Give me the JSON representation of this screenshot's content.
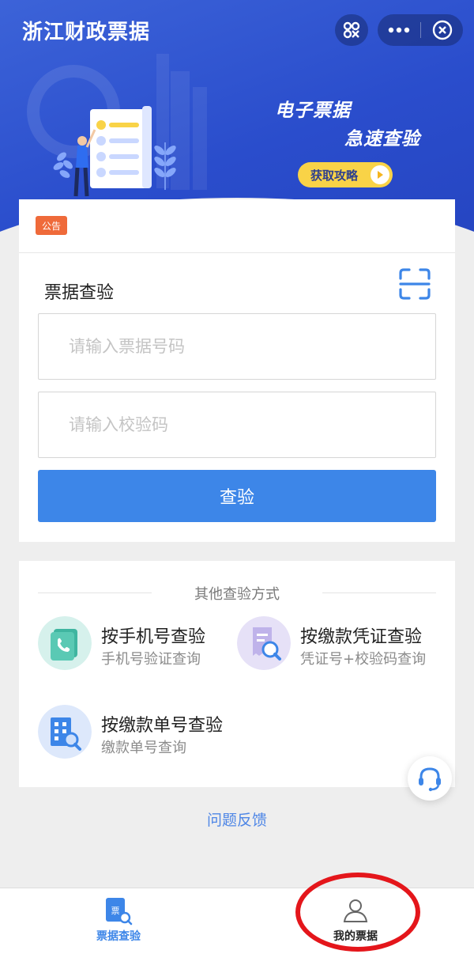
{
  "header": {
    "title": "浙江财政票据"
  },
  "banner": {
    "slogan_line1": "电子票据",
    "slogan_line2": "急速查验",
    "guide_button": "获取攻略"
  },
  "notice": {
    "badge": "公告"
  },
  "verify": {
    "title": "票据查验",
    "bill_number_placeholder": "请输入票据号码",
    "check_code_placeholder": "请输入校验码",
    "submit_label": "查验"
  },
  "other_methods": {
    "title": "其他查验方式",
    "items": [
      {
        "title": "按手机号查验",
        "subtitle": "手机号验证查询",
        "icon": "phone-book-icon"
      },
      {
        "title": "按缴款凭证查验",
        "subtitle": "凭证号+校验码查询",
        "icon": "receipt-search-icon"
      },
      {
        "title": "按缴款单号查验",
        "subtitle": "缴款单号查询",
        "icon": "building-search-icon"
      }
    ]
  },
  "feedback": {
    "label": "问题反馈"
  },
  "tabbar": {
    "tabs": [
      {
        "label": "票据查验",
        "icon": "bill-search-icon",
        "active": true
      },
      {
        "label": "我的票据",
        "icon": "user-icon",
        "active": false
      }
    ]
  },
  "colors": {
    "brand_blue": "#2a4dcc",
    "button_blue": "#3d86e8",
    "notice_orange": "#ef6a3a",
    "guide_yellow": "#f9d347",
    "highlight_red": "#e4161b"
  }
}
